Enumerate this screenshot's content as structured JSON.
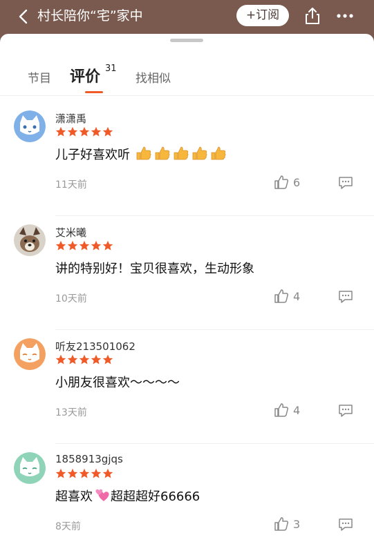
{
  "header": {
    "title": "村长陪你“宅”家中",
    "subscribe_label": "+订阅"
  },
  "tabs": {
    "programs": "节目",
    "reviews": "评价",
    "reviews_count": "31",
    "similar": "找相似"
  },
  "colors": {
    "header_bg": "#7a5a4f",
    "accent": "#f05a28",
    "star": "#f05a28"
  },
  "reviews": [
    {
      "username": "潇潇禹",
      "rating": 5,
      "text": "儿子好喜欢听",
      "emoji": "thumbs-up x5",
      "time": "11天前",
      "likes": "6",
      "avatar_icon": "blue-cat-avatar"
    },
    {
      "username": "艾米曦",
      "rating": 5,
      "text": "讲的特别好！宝贝很喜欢，生动形象",
      "emoji": "",
      "time": "10天前",
      "likes": "4",
      "avatar_icon": "dog-photo-avatar"
    },
    {
      "username": "听友213501062",
      "rating": 5,
      "text": "小朋友很喜欢～～～～",
      "emoji": "",
      "time": "13天前",
      "likes": "4",
      "avatar_icon": "orange-cat-avatar"
    },
    {
      "username": "1858913gjqs",
      "rating": 5,
      "text_before": "超喜欢",
      "text_after": "超超超好66666",
      "emoji": "two-hearts",
      "time": "8天前",
      "likes": "3",
      "avatar_icon": "green-cat-avatar"
    }
  ]
}
